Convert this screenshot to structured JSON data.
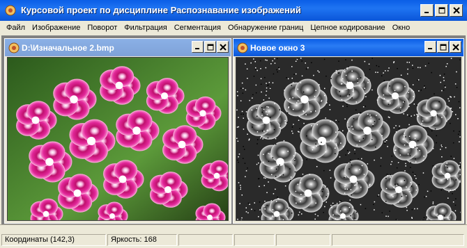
{
  "app": {
    "title": "Курсовой проект по дисциплине Распознавание изображений"
  },
  "menu": [
    "Файл",
    "Изображение",
    "Поворот",
    "Фильтрация",
    "Сегментация",
    "Обнаружение границ",
    "Цепное кодирование",
    "Окно"
  ],
  "windows": [
    {
      "title": "D:\\Изначальное 2.bmp",
      "state": "inactive",
      "image": "pink-carnation-flowers"
    },
    {
      "title": "Новое окно 3",
      "state": "active",
      "image": "grayscale-flowers-with-noise"
    }
  ],
  "status": {
    "coords": "Координаты (142,3)",
    "brightness": "Яркость: 168"
  },
  "colors": {
    "titlebar": "#0a5ee6",
    "menubar": "#ece9d8",
    "mdi_background": "#808080",
    "flower_pink": "#e0208c"
  }
}
